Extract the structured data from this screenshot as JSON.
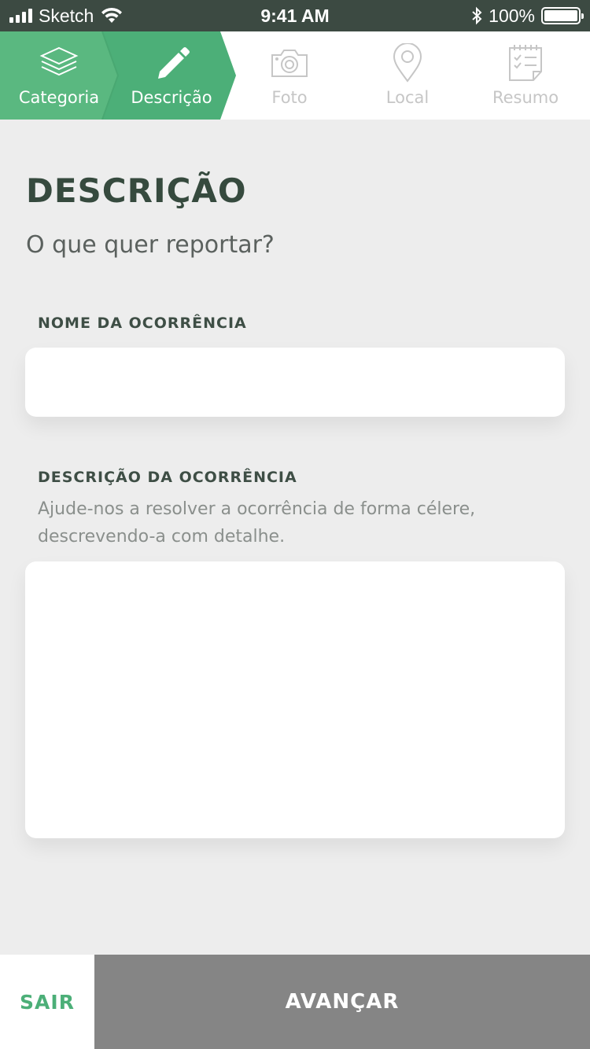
{
  "status_bar": {
    "carrier": "Sketch",
    "time": "9:41 AM",
    "battery": "100%"
  },
  "steps": [
    {
      "label": "Categoria",
      "icon": "layers-icon",
      "state": "done"
    },
    {
      "label": "Descrição",
      "icon": "pencil-icon",
      "state": "active"
    },
    {
      "label": "Foto",
      "icon": "camera-icon",
      "state": "todo"
    },
    {
      "label": "Local",
      "icon": "location-pin-icon",
      "state": "todo"
    },
    {
      "label": "Resumo",
      "icon": "checklist-icon",
      "state": "todo"
    }
  ],
  "main": {
    "title": "DESCRIÇÃO",
    "subtitle": "O que quer reportar?",
    "name_field": {
      "label": "NOME DA OCORRÊNCIA",
      "value": "",
      "placeholder": ""
    },
    "description_field": {
      "label": "DESCRIÇÃO DA OCORRÊNCIA",
      "help": "Ajude-nos a resolver a ocorrência de forma célere, descrevendo-a com detalhe.",
      "value": "",
      "placeholder": ""
    }
  },
  "footer": {
    "exit_label": "SAIR",
    "next_label": "AVANÇAR"
  },
  "colors": {
    "accent": "#4caf78",
    "accent_done": "#59b67f",
    "dark_text": "#364a3e",
    "status_bar": "#3c4a42",
    "next_button": "#858585",
    "background": "#ededed",
    "inactive_step": "#c6c6c6"
  }
}
